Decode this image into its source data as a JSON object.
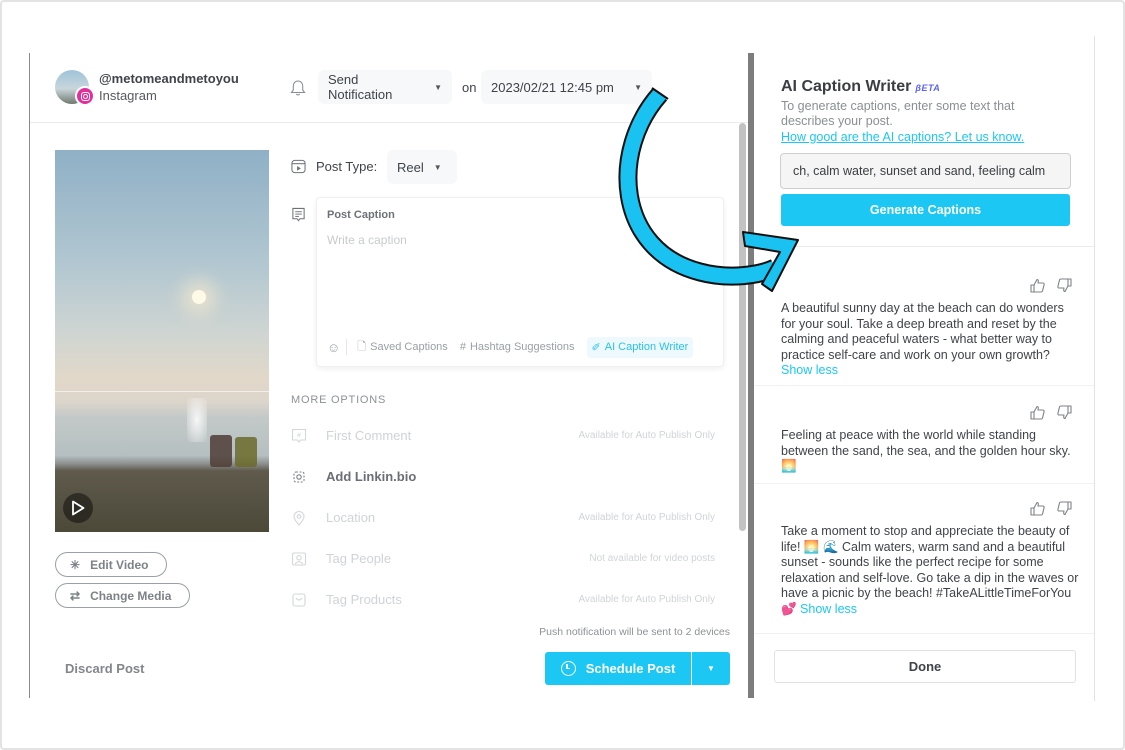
{
  "account": {
    "username": "@metomeandmetoyou",
    "network": "Instagram"
  },
  "header": {
    "notification_select": "Send Notification",
    "on_label": "on",
    "datetime_select": "2023/02/21 12:45 pm"
  },
  "media": {
    "edit_video_label": "Edit Video",
    "change_media_label": "Change Media"
  },
  "post_type": {
    "label": "Post Type:",
    "value": "Reel"
  },
  "caption": {
    "title": "Post Caption",
    "placeholder": "Write a caption",
    "value": "",
    "tools": {
      "saved_captions": "Saved Captions",
      "hashtag_suggestions": "Hashtag Suggestions",
      "ai_caption_writer": "AI Caption Writer"
    }
  },
  "more_options": {
    "heading": "MORE OPTIONS",
    "items": [
      {
        "label": "First Comment",
        "note": "Available for Auto Publish Only",
        "enabled": false,
        "icon": "hashtag-comment-icon"
      },
      {
        "label": "Add Linkin.bio",
        "note": "",
        "enabled": true,
        "icon": "linkinbio-icon"
      },
      {
        "label": "Location",
        "note": "Available for Auto Publish Only",
        "enabled": false,
        "icon": "location-pin-icon"
      },
      {
        "label": "Tag People",
        "note": "Not available for video posts",
        "enabled": false,
        "icon": "tag-person-icon"
      },
      {
        "label": "Tag Products",
        "note": "Available for Auto Publish Only",
        "enabled": false,
        "icon": "shopping-bag-icon"
      }
    ]
  },
  "footer": {
    "push_note": "Push notification will be sent to 2 devices",
    "discard_label": "Discard Post",
    "schedule_label": "Schedule Post"
  },
  "ai_panel": {
    "title": "AI Caption Writer",
    "beta": "BETA",
    "beta_display": "βETA",
    "description": "To generate captions, enter some text that describes your post.",
    "feedback_link": "How good are the AI captions? Let us know.",
    "input_value": "ch, calm water, sunset and sand, feeling calm",
    "generate_label": "Generate Captions",
    "results": [
      {
        "text": "A beautiful sunny day at the beach can do wonders for your soul. Take a deep breath and reset by the calming and peaceful waters - what better way to practice self-care and work on your own growth? ",
        "toggle": "Show less"
      },
      {
        "text": "Feeling at peace with the world while standing between the sand, the sea, and the golden hour sky. 🌅",
        "toggle": ""
      },
      {
        "text": "Take a moment to stop and appreciate the beauty of life! 🌅 🌊 Calm waters, warm sand and a beautiful sunset - sounds like the perfect recipe for some relaxation and self-love. Go take a dip in the waves or have a picnic by the beach! #TakeALittleTimeForYou 💕 ",
        "toggle": "Show less"
      }
    ],
    "done_label": "Done"
  },
  "colors": {
    "accent": "#1cc7f4",
    "instagram": "#e1309c",
    "beta": "#5b63f0",
    "annotation_arrow": "#1cc7f4"
  }
}
